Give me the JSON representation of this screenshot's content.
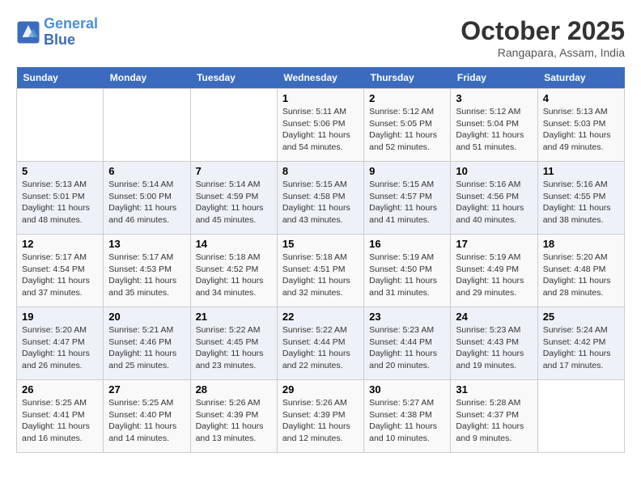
{
  "header": {
    "logo_line1": "General",
    "logo_line2": "Blue",
    "month": "October 2025",
    "location": "Rangapara, Assam, India"
  },
  "days_of_week": [
    "Sunday",
    "Monday",
    "Tuesday",
    "Wednesday",
    "Thursday",
    "Friday",
    "Saturday"
  ],
  "weeks": [
    [
      {
        "day": "",
        "sunrise": "",
        "sunset": "",
        "daylight": ""
      },
      {
        "day": "",
        "sunrise": "",
        "sunset": "",
        "daylight": ""
      },
      {
        "day": "",
        "sunrise": "",
        "sunset": "",
        "daylight": ""
      },
      {
        "day": "1",
        "sunrise": "Sunrise: 5:11 AM",
        "sunset": "Sunset: 5:06 PM",
        "daylight": "Daylight: 11 hours and 54 minutes."
      },
      {
        "day": "2",
        "sunrise": "Sunrise: 5:12 AM",
        "sunset": "Sunset: 5:05 PM",
        "daylight": "Daylight: 11 hours and 52 minutes."
      },
      {
        "day": "3",
        "sunrise": "Sunrise: 5:12 AM",
        "sunset": "Sunset: 5:04 PM",
        "daylight": "Daylight: 11 hours and 51 minutes."
      },
      {
        "day": "4",
        "sunrise": "Sunrise: 5:13 AM",
        "sunset": "Sunset: 5:03 PM",
        "daylight": "Daylight: 11 hours and 49 minutes."
      }
    ],
    [
      {
        "day": "5",
        "sunrise": "Sunrise: 5:13 AM",
        "sunset": "Sunset: 5:01 PM",
        "daylight": "Daylight: 11 hours and 48 minutes."
      },
      {
        "day": "6",
        "sunrise": "Sunrise: 5:14 AM",
        "sunset": "Sunset: 5:00 PM",
        "daylight": "Daylight: 11 hours and 46 minutes."
      },
      {
        "day": "7",
        "sunrise": "Sunrise: 5:14 AM",
        "sunset": "Sunset: 4:59 PM",
        "daylight": "Daylight: 11 hours and 45 minutes."
      },
      {
        "day": "8",
        "sunrise": "Sunrise: 5:15 AM",
        "sunset": "Sunset: 4:58 PM",
        "daylight": "Daylight: 11 hours and 43 minutes."
      },
      {
        "day": "9",
        "sunrise": "Sunrise: 5:15 AM",
        "sunset": "Sunset: 4:57 PM",
        "daylight": "Daylight: 11 hours and 41 minutes."
      },
      {
        "day": "10",
        "sunrise": "Sunrise: 5:16 AM",
        "sunset": "Sunset: 4:56 PM",
        "daylight": "Daylight: 11 hours and 40 minutes."
      },
      {
        "day": "11",
        "sunrise": "Sunrise: 5:16 AM",
        "sunset": "Sunset: 4:55 PM",
        "daylight": "Daylight: 11 hours and 38 minutes."
      }
    ],
    [
      {
        "day": "12",
        "sunrise": "Sunrise: 5:17 AM",
        "sunset": "Sunset: 4:54 PM",
        "daylight": "Daylight: 11 hours and 37 minutes."
      },
      {
        "day": "13",
        "sunrise": "Sunrise: 5:17 AM",
        "sunset": "Sunset: 4:53 PM",
        "daylight": "Daylight: 11 hours and 35 minutes."
      },
      {
        "day": "14",
        "sunrise": "Sunrise: 5:18 AM",
        "sunset": "Sunset: 4:52 PM",
        "daylight": "Daylight: 11 hours and 34 minutes."
      },
      {
        "day": "15",
        "sunrise": "Sunrise: 5:18 AM",
        "sunset": "Sunset: 4:51 PM",
        "daylight": "Daylight: 11 hours and 32 minutes."
      },
      {
        "day": "16",
        "sunrise": "Sunrise: 5:19 AM",
        "sunset": "Sunset: 4:50 PM",
        "daylight": "Daylight: 11 hours and 31 minutes."
      },
      {
        "day": "17",
        "sunrise": "Sunrise: 5:19 AM",
        "sunset": "Sunset: 4:49 PM",
        "daylight": "Daylight: 11 hours and 29 minutes."
      },
      {
        "day": "18",
        "sunrise": "Sunrise: 5:20 AM",
        "sunset": "Sunset: 4:48 PM",
        "daylight": "Daylight: 11 hours and 28 minutes."
      }
    ],
    [
      {
        "day": "19",
        "sunrise": "Sunrise: 5:20 AM",
        "sunset": "Sunset: 4:47 PM",
        "daylight": "Daylight: 11 hours and 26 minutes."
      },
      {
        "day": "20",
        "sunrise": "Sunrise: 5:21 AM",
        "sunset": "Sunset: 4:46 PM",
        "daylight": "Daylight: 11 hours and 25 minutes."
      },
      {
        "day": "21",
        "sunrise": "Sunrise: 5:22 AM",
        "sunset": "Sunset: 4:45 PM",
        "daylight": "Daylight: 11 hours and 23 minutes."
      },
      {
        "day": "22",
        "sunrise": "Sunrise: 5:22 AM",
        "sunset": "Sunset: 4:44 PM",
        "daylight": "Daylight: 11 hours and 22 minutes."
      },
      {
        "day": "23",
        "sunrise": "Sunrise: 5:23 AM",
        "sunset": "Sunset: 4:44 PM",
        "daylight": "Daylight: 11 hours and 20 minutes."
      },
      {
        "day": "24",
        "sunrise": "Sunrise: 5:23 AM",
        "sunset": "Sunset: 4:43 PM",
        "daylight": "Daylight: 11 hours and 19 minutes."
      },
      {
        "day": "25",
        "sunrise": "Sunrise: 5:24 AM",
        "sunset": "Sunset: 4:42 PM",
        "daylight": "Daylight: 11 hours and 17 minutes."
      }
    ],
    [
      {
        "day": "26",
        "sunrise": "Sunrise: 5:25 AM",
        "sunset": "Sunset: 4:41 PM",
        "daylight": "Daylight: 11 hours and 16 minutes."
      },
      {
        "day": "27",
        "sunrise": "Sunrise: 5:25 AM",
        "sunset": "Sunset: 4:40 PM",
        "daylight": "Daylight: 11 hours and 14 minutes."
      },
      {
        "day": "28",
        "sunrise": "Sunrise: 5:26 AM",
        "sunset": "Sunset: 4:39 PM",
        "daylight": "Daylight: 11 hours and 13 minutes."
      },
      {
        "day": "29",
        "sunrise": "Sunrise: 5:26 AM",
        "sunset": "Sunset: 4:39 PM",
        "daylight": "Daylight: 11 hours and 12 minutes."
      },
      {
        "day": "30",
        "sunrise": "Sunrise: 5:27 AM",
        "sunset": "Sunset: 4:38 PM",
        "daylight": "Daylight: 11 hours and 10 minutes."
      },
      {
        "day": "31",
        "sunrise": "Sunrise: 5:28 AM",
        "sunset": "Sunset: 4:37 PM",
        "daylight": "Daylight: 11 hours and 9 minutes."
      },
      {
        "day": "",
        "sunrise": "",
        "sunset": "",
        "daylight": ""
      }
    ]
  ]
}
